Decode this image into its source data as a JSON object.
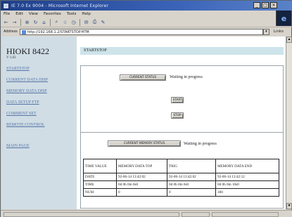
{
  "window": {
    "title": "IE 7.0 Ex 9004 - Microsoft Internet Explorer",
    "controls": [
      "_",
      "□",
      "×"
    ]
  },
  "menu": [
    "File",
    "Edit",
    "View",
    "Favorites",
    "Tools",
    "Help"
  ],
  "toolbar": {
    "buttons": [
      {
        "name": "back",
        "glyph": "←"
      },
      {
        "name": "forward",
        "glyph": "→"
      },
      {
        "name": "stop",
        "glyph": "⊗"
      },
      {
        "name": "refresh",
        "glyph": "↻"
      },
      {
        "name": "home",
        "glyph": "⌂"
      },
      {
        "name": "search",
        "glyph": "⌕"
      },
      {
        "name": "favorites",
        "glyph": "☆"
      },
      {
        "name": "history",
        "glyph": "◷"
      },
      {
        "name": "mail",
        "glyph": "✉"
      },
      {
        "name": "print",
        "glyph": "⎙"
      },
      {
        "name": "edit",
        "glyph": "✎"
      }
    ]
  },
  "address": {
    "label": "Address",
    "value": "http://192.168.1.2/STARTSTOP.HTM",
    "go": "Links"
  },
  "nav": {
    "brand": "HIOKI 8422",
    "version": "V 1.03",
    "links": [
      "STARTSTOP",
      "CURRENT DATA DISP",
      "MEMORY DATA DISP",
      "DATA SETUP FTP",
      "COMMENT SET",
      "REMOTE CONTROL",
      "MAIN PAGE"
    ]
  },
  "page": {
    "header": "STARTSTOP",
    "current_status_button": "CURRENT STATUS",
    "current_status_text": "Waiting in progress",
    "start_button": "START",
    "stop_button": "STOP",
    "memory_status_button": "CURRENT MEMORY STATUS",
    "memory_status_text": "Waiting in progress"
  },
  "table": {
    "header": [
      "TIME VALUE",
      "MEMORY DATA TOP",
      "TRIG",
      "MEMORY DATA END"
    ],
    "rows": [
      [
        "DATE",
        "92-06-14 13:42:02",
        "92-06-14 13:42:02",
        "92-06-14 13:42:12"
      ],
      [
        "TIME",
        "0d 0h 0m 0s0",
        "0d 0h 0m 0s0",
        "0d 0h 0m 10s0"
      ],
      [
        "NUM",
        "0",
        "0",
        "300"
      ]
    ]
  }
}
